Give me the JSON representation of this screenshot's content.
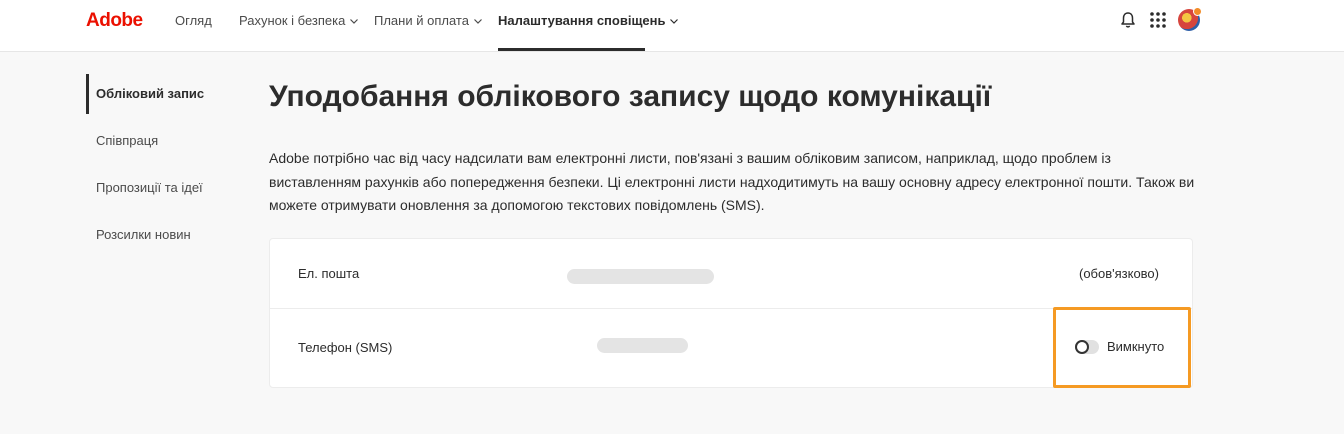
{
  "brand": {
    "logo": "Adobe",
    "color": "#eb1000"
  },
  "nav": {
    "items": [
      {
        "label": "Огляд"
      },
      {
        "label": "Рахунок і безпека"
      },
      {
        "label": "Плани й оплата"
      },
      {
        "label": "Налаштування сповіщень"
      }
    ],
    "active_index": 3
  },
  "topbar_icons": [
    "bell-icon",
    "apps-grid-icon",
    "avatar"
  ],
  "sidebar": {
    "items": [
      {
        "label": "Обліковий запис"
      },
      {
        "label": "Співпраця"
      },
      {
        "label": "Пропозиції та ідеї"
      },
      {
        "label": "Розсилки новин"
      }
    ],
    "active_index": 0
  },
  "main": {
    "title": "Уподобання облікового запису щодо комунікації",
    "description": "Adobe потрібно час від часу надсилати вам електронні листи, пов'язані з вашим обліковим записом, наприклад, щодо проблем із виставленням рахунків або попередження безпеки. Ці електронні листи надходитимуть на вашу основну адресу електронної пошти. Також ви можете отримувати оновлення за допомогою текстових повідомлень (SMS).",
    "rows": [
      {
        "label": "Ел. пошта",
        "status": "(обов'язково)"
      },
      {
        "label": "Телефон (SMS)",
        "toggle_label": "Вимкнуто",
        "toggle_on": false
      }
    ]
  },
  "colors": {
    "highlight": "#f59a23",
    "text": "#2c2c2c",
    "background": "#f8f8f8"
  }
}
